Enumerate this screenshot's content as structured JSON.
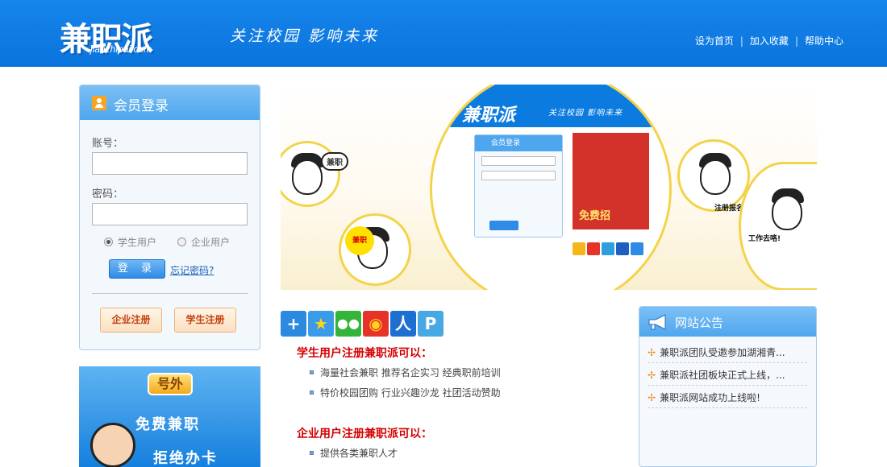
{
  "header": {
    "logo_text": "兼职派",
    "logo_domain": "jianzhipai.com",
    "slogan": "关注校园  影响未来",
    "links": [
      "设为首页",
      "加入收藏",
      "帮助中心"
    ]
  },
  "login": {
    "title": "会员登录",
    "account_label": "账号：",
    "password_label": "密码：",
    "account_value": "",
    "password_value": "",
    "role_student": "学生用户",
    "role_company": "企业用户",
    "selected_role": "学生用户",
    "login_button": "登 录",
    "forgot": "忘记密码?",
    "register_company": "企业注册",
    "register_student": "学生注册"
  },
  "ad": {
    "tag": "号外",
    "line1": "免费兼职",
    "line2": "拒绝办卡"
  },
  "banner": {
    "logo": "兼职派",
    "slogan": "关注校园  影响未来",
    "mini_login_title": "会员登录",
    "bubble_1": "兼职",
    "burst": "兼职",
    "free_text": "免费招",
    "tag_right": "注册报名",
    "go_work": "工作去咯!"
  },
  "share_icons": [
    "plus-icon",
    "qzone-icon",
    "wechat-icon",
    "weibo-icon",
    "renren-icon",
    "tencent-weibo-icon"
  ],
  "student_section": {
    "title": "学生用户注册兼职派可以：",
    "items": [
      "海量社会兼职  推荐名企实习  经典职前培训",
      "特价校园团购  行业兴趣沙龙  社团活动赞助"
    ]
  },
  "company_section": {
    "title": "企业用户注册兼职派可以：",
    "items": [
      "提供各类兼职人才"
    ]
  },
  "notice": {
    "title": "网站公告",
    "items": [
      "兼职派团队受邀参加湖湘青...",
      "兼职派社团板块正式上线，...",
      "兼职派网站成功上线啦!"
    ]
  },
  "colors": {
    "header_blue": "#0a74dd",
    "panel_blue": "#4ea6ee",
    "accent_red": "#d40000",
    "register_orange": "#c4410e"
  }
}
